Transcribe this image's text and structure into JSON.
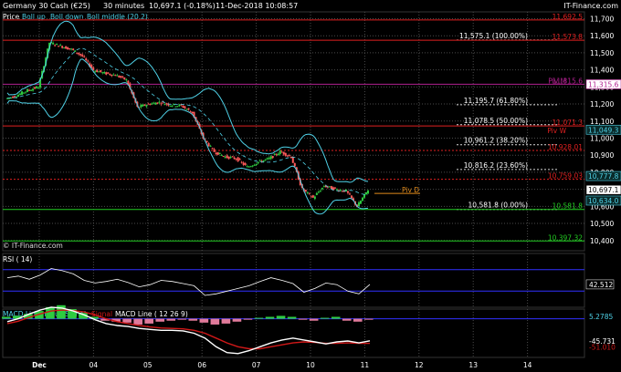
{
  "header": {
    "instrument": "Germany 30 Cash (€25)",
    "timeframe": "30 minutes",
    "last": "10,697.1 (-0.18%)",
    "datetime": "11-Dec-2018 10:08:57",
    "brand": "IT-Finance.com"
  },
  "legend": {
    "price": "Price",
    "boll_up": "Boll up",
    "boll_down": "Boll down",
    "boll_middle": "Boll middle (20.2)"
  },
  "watermark": "© IT-Finance.com",
  "colors": {
    "background": "#000000",
    "up_candle": "#2ecc40",
    "down_candle": "#ff5a5a",
    "bollinger": "#4fd2e8",
    "resistance": "#e02020",
    "support": "#22cc22",
    "pivot": "#b0208f",
    "fib": "#d8d8d8",
    "pivot_d": "#e08a1a",
    "grid": "#4a4a4a",
    "rsi_band": "#3030ff",
    "macd_line": "#ffffff",
    "signal_line": "#d01818"
  },
  "chart_data": [
    {
      "type": "candlestick",
      "name": "price",
      "ylim": [
        10340,
        11740
      ],
      "y_ticks": [
        "11,700",
        "11,600",
        "11,500",
        "11,400",
        "11,300",
        "11,200",
        "11,100",
        "11,000",
        "10,900",
        "10,800",
        "10,700",
        "10,600",
        "10,500",
        "10,400"
      ],
      "x_ticks": [
        "Dec",
        "04",
        "05",
        "06",
        "07",
        "10",
        "11",
        "12",
        "13",
        "14"
      ],
      "last_price": 10697.1,
      "levels": [
        {
          "value": 11692.5,
          "label": "11,692.5",
          "kind": "resistance"
        },
        {
          "value": 11575.1,
          "label": "11,575.1 (100.00%)",
          "kind": "fib"
        },
        {
          "value": 11573.8,
          "label": "11,573.8",
          "kind": "resistance"
        },
        {
          "value": 11315.6,
          "label": "11,315.6",
          "kind": "pivot",
          "name": "Piv M"
        },
        {
          "value": 11195.7,
          "label": "11,195.7 (61.80%)",
          "kind": "fib"
        },
        {
          "value": 11078.5,
          "label": "11,078.5 (50.00%)",
          "kind": "fib"
        },
        {
          "value": 11071.3,
          "label": "11,071.3",
          "kind": "resistance",
          "name": "Piv W"
        },
        {
          "value": 11049.3,
          "label": "11,049.3",
          "kind": "bollinger_up"
        },
        {
          "value": 10961.2,
          "label": "10,961.2 (38.20%)",
          "kind": "fib"
        },
        {
          "value": 10928.01,
          "label": "10,928.01",
          "kind": "resistance"
        },
        {
          "value": 10816.2,
          "label": "10,816.2 (23.60%)",
          "kind": "fib"
        },
        {
          "value": 10777.8,
          "label": "10,777.8",
          "kind": "bollinger_mid"
        },
        {
          "value": 10759.03,
          "label": "10,759.03",
          "kind": "resistance"
        },
        {
          "value": 10697.1,
          "label": "10,697.1",
          "kind": "last"
        },
        {
          "value": 10676.1,
          "label": "10,676.1",
          "kind": "pivot_d",
          "name": "Piv D"
        },
        {
          "value": 10634.0,
          "label": "10,634.0",
          "kind": "bollinger_down"
        },
        {
          "value": 10581.8,
          "label": "10,581.8 (0.00%)",
          "kind": "fib"
        },
        {
          "value": 10581.8,
          "label": "10,581.8",
          "kind": "support"
        },
        {
          "value": 10397.32,
          "label": "10,397.32",
          "kind": "support"
        }
      ],
      "approx_close_path": [
        11230,
        11250,
        11280,
        11300,
        11560,
        11540,
        11520,
        11480,
        11400,
        11380,
        11370,
        11340,
        11180,
        11200,
        11210,
        11195,
        11190,
        11150,
        11000,
        10920,
        10890,
        10880,
        10830,
        10860,
        10880,
        10920,
        10890,
        10700,
        10650,
        10720,
        10700,
        10690,
        10600,
        10697
      ]
    },
    {
      "type": "line",
      "name": "RSI (14)",
      "title": "RSI ( 14)",
      "ylim": [
        0,
        100
      ],
      "bands": [
        70,
        30
      ],
      "last_value": 42.512,
      "last_label": "42.512",
      "values": [
        55,
        58,
        52,
        60,
        72,
        68,
        62,
        50,
        45,
        48,
        52,
        46,
        38,
        42,
        50,
        48,
        44,
        40,
        22,
        25,
        30,
        35,
        40,
        48,
        55,
        50,
        44,
        28,
        35,
        45,
        42,
        30,
        25,
        42.5
      ]
    },
    {
      "type": "line",
      "name": "MACD",
      "title_parts": [
        "MACD Line minus Signal",
        "Signal",
        "MACD Line ( 12 26 9)"
      ],
      "ylim": [
        -80,
        20
      ],
      "ticks": [
        "5.2785",
        "-45.731",
        "-51.010"
      ],
      "zero": 0,
      "histogram": [
        2,
        3,
        5,
        8,
        12,
        14,
        10,
        6,
        2,
        -2,
        -3,
        -4,
        -6,
        -5,
        -3,
        -2,
        -1,
        -2,
        -4,
        -6,
        -5,
        -3,
        -1,
        1,
        2,
        3,
        2,
        -1,
        -2,
        1,
        2,
        -2,
        -3,
        -1
      ],
      "macd_line": [
        -6,
        0,
        10,
        18,
        24,
        22,
        16,
        8,
        -2,
        -10,
        -14,
        -16,
        -20,
        -22,
        -24,
        -24,
        -25,
        -30,
        -40,
        -58,
        -70,
        -72,
        -66,
        -58,
        -50,
        -44,
        -40,
        -44,
        -48,
        -52,
        -48,
        -46,
        -50,
        -45.7
      ],
      "signal_line": [
        -10,
        -5,
        3,
        10,
        16,
        18,
        17,
        14,
        8,
        0,
        -6,
        -10,
        -14,
        -17,
        -19,
        -20,
        -21,
        -24,
        -30,
        -40,
        -50,
        -58,
        -62,
        -62,
        -58,
        -54,
        -50,
        -48,
        -49,
        -51,
        -51,
        -50,
        -51,
        -51.0
      ]
    }
  ]
}
